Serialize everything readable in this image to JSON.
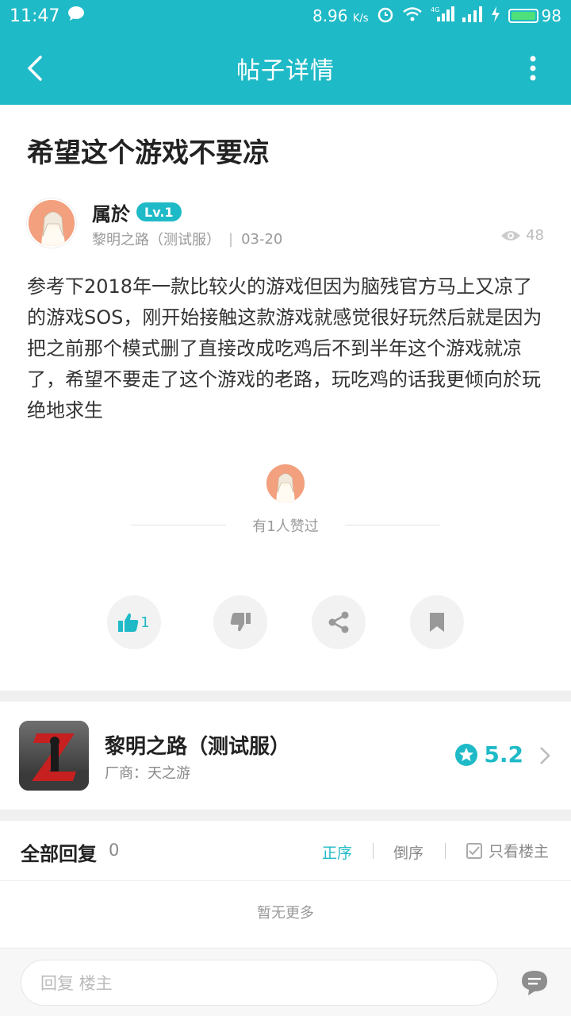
{
  "status_bar": {
    "time": "11:47",
    "speed": "8.96",
    "speed_unit": "K/s",
    "network_tag": "4G",
    "battery": "98"
  },
  "header": {
    "title": "帖子详情"
  },
  "post": {
    "title": "希望这个游戏不要凉",
    "author": {
      "name": "属於",
      "level": "Lv.1",
      "source": "黎明之路（测试服）",
      "separator": "|",
      "date": "03-20",
      "views": "48"
    },
    "body": "参考下2018年一款比较火的游戏但因为脑残官方马上又凉了的游戏SOS，刚开始接触这款游戏就感觉很好玩然后就是因为把之前那个模式删了直接改成吃鸡后不到半年这个游戏就凉了，希望不要走了这个游戏的老路，玩吃鸡的话我更倾向於玩绝地求生",
    "likes_text": "有1人赞过",
    "like_count": "1"
  },
  "game_card": {
    "name": "黎明之路（测试服）",
    "vendor": "厂商：天之游",
    "rating": "5.2"
  },
  "replies": {
    "title": "全部回复",
    "count": "0",
    "sort_asc": "正序",
    "sort_desc": "倒序",
    "only_op": "只看楼主",
    "no_more": "暂无更多"
  },
  "bottom_bar": {
    "placeholder": "回复  楼主"
  },
  "colors": {
    "accent": "#1fbac7",
    "avatar_bg": "#f3a07e"
  }
}
